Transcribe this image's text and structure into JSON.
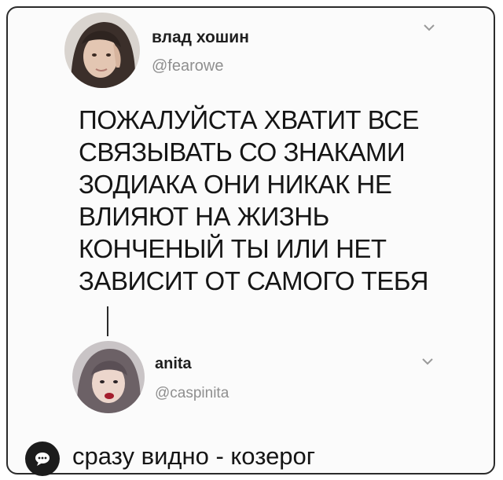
{
  "tweet": {
    "author_name": "влад хошин",
    "author_handle": "@fearowe",
    "lines": [
      "ПОЖАЛУЙСТА ХВАТИТ ВСЕ",
      "СВЯЗЫВАТЬ СО ЗНАКАМИ",
      "ЗОДИАКА ОНИ НИКАК НЕ",
      "ВЛИЯЮТ НА ЖИЗНЬ",
      "КОНЧЕНЫЙ ТЫ ИЛИ НЕТ",
      "ЗАВИСИТ ОТ САМОГО ТЕБЯ"
    ],
    "menu_icon": "chevron-down-icon"
  },
  "reply_account": {
    "name": "anita",
    "handle": "@caspinita",
    "menu_icon": "chevron-down-icon"
  },
  "reply": {
    "badge_icon": "speech-bubble-icon",
    "text": "сразу видно - козерог"
  },
  "colors": {
    "text": "#151515",
    "muted": "#8f8f8f",
    "border": "#2b2b2b"
  }
}
